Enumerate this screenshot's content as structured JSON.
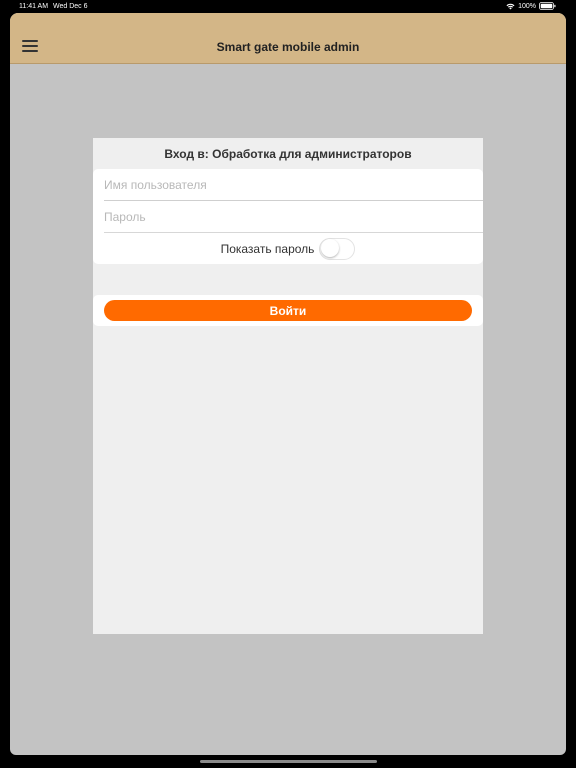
{
  "status_bar": {
    "time": "11:41 AM",
    "date": "Wed Dec 6",
    "battery": "100%",
    "wifi_icon": "wifi-icon",
    "battery_icon": "battery-icon"
  },
  "header": {
    "title": "Smart gate mobile admin",
    "menu_icon": "hamburger-menu-icon",
    "background": "#d3b687"
  },
  "login": {
    "title": "Вход в: Обработка для администраторов",
    "username": {
      "value": "",
      "placeholder": "Имя пользователя"
    },
    "password": {
      "value": "",
      "placeholder": "Пароль"
    },
    "show_password": {
      "label": "Показать пароль",
      "checked": false
    },
    "submit_label": "Войти",
    "accent": "#ff6a00"
  }
}
